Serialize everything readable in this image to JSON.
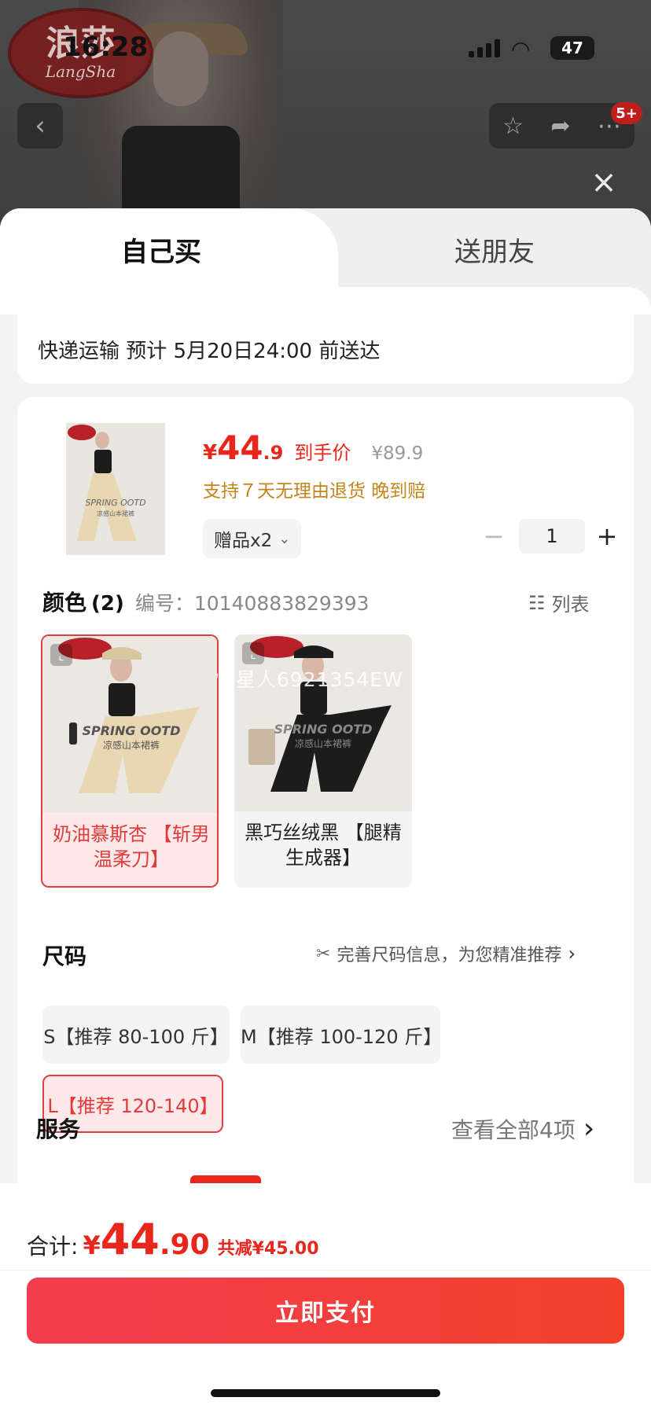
{
  "status_bar": {
    "time": "16:28",
    "battery": "47"
  },
  "store_logo": {
    "line1": "浪莎",
    "line2": "LangSha"
  },
  "nav": {
    "cart_badge": "5+"
  },
  "tabs": [
    {
      "label": "自己买"
    },
    {
      "label": "送朋友"
    }
  ],
  "delivery": {
    "text": "快递运输 预计 5月20日24:00 前送达"
  },
  "product": {
    "price_currency": "¥",
    "price_int": "44",
    "price_dec": ".9",
    "price_label": "到手价",
    "original_price": "¥89.9",
    "service_note": "支持７天无理由退货   晚到赔",
    "gift_label": "赠品x2",
    "quantity": "1",
    "thumb_text": "SPRING OOTD",
    "thumb_subtext": "凉感山本裙裤"
  },
  "color_section": {
    "title": "颜色",
    "count": "(2)",
    "code": "编号：10140883829393",
    "list_label": "列表",
    "watermark": "慢星人6921354EW",
    "options": [
      {
        "label": "奶油慕斯杏 【斩男温柔刀】",
        "selected": true,
        "pants_color": "#e9d7b3"
      },
      {
        "label": "黑巧丝绒黑 【腿精生成器】",
        "selected": false,
        "pants_color": "#1c1c1c"
      }
    ]
  },
  "size_section": {
    "title": "尺码",
    "tip": "完善尺码信息，为您精准推荐",
    "options": [
      {
        "label": "S【推荐 80-100 斤】",
        "selected": false
      },
      {
        "label": "M【推荐 100-120 斤】",
        "selected": false
      },
      {
        "label": "L【推荐 120-140】",
        "selected": true
      }
    ]
  },
  "service_section": {
    "title": "服务",
    "more": "查看全部4项"
  },
  "footer": {
    "total_label": "合计:",
    "total_currency": "¥",
    "total_int": "44",
    "total_dec": ".90",
    "discount": "共减¥45.00",
    "pay_label": "立即支付"
  },
  "colors": {
    "accent": "#e8261c",
    "selected_bg": "#fde9ea",
    "gold_note": "#c4841e"
  }
}
